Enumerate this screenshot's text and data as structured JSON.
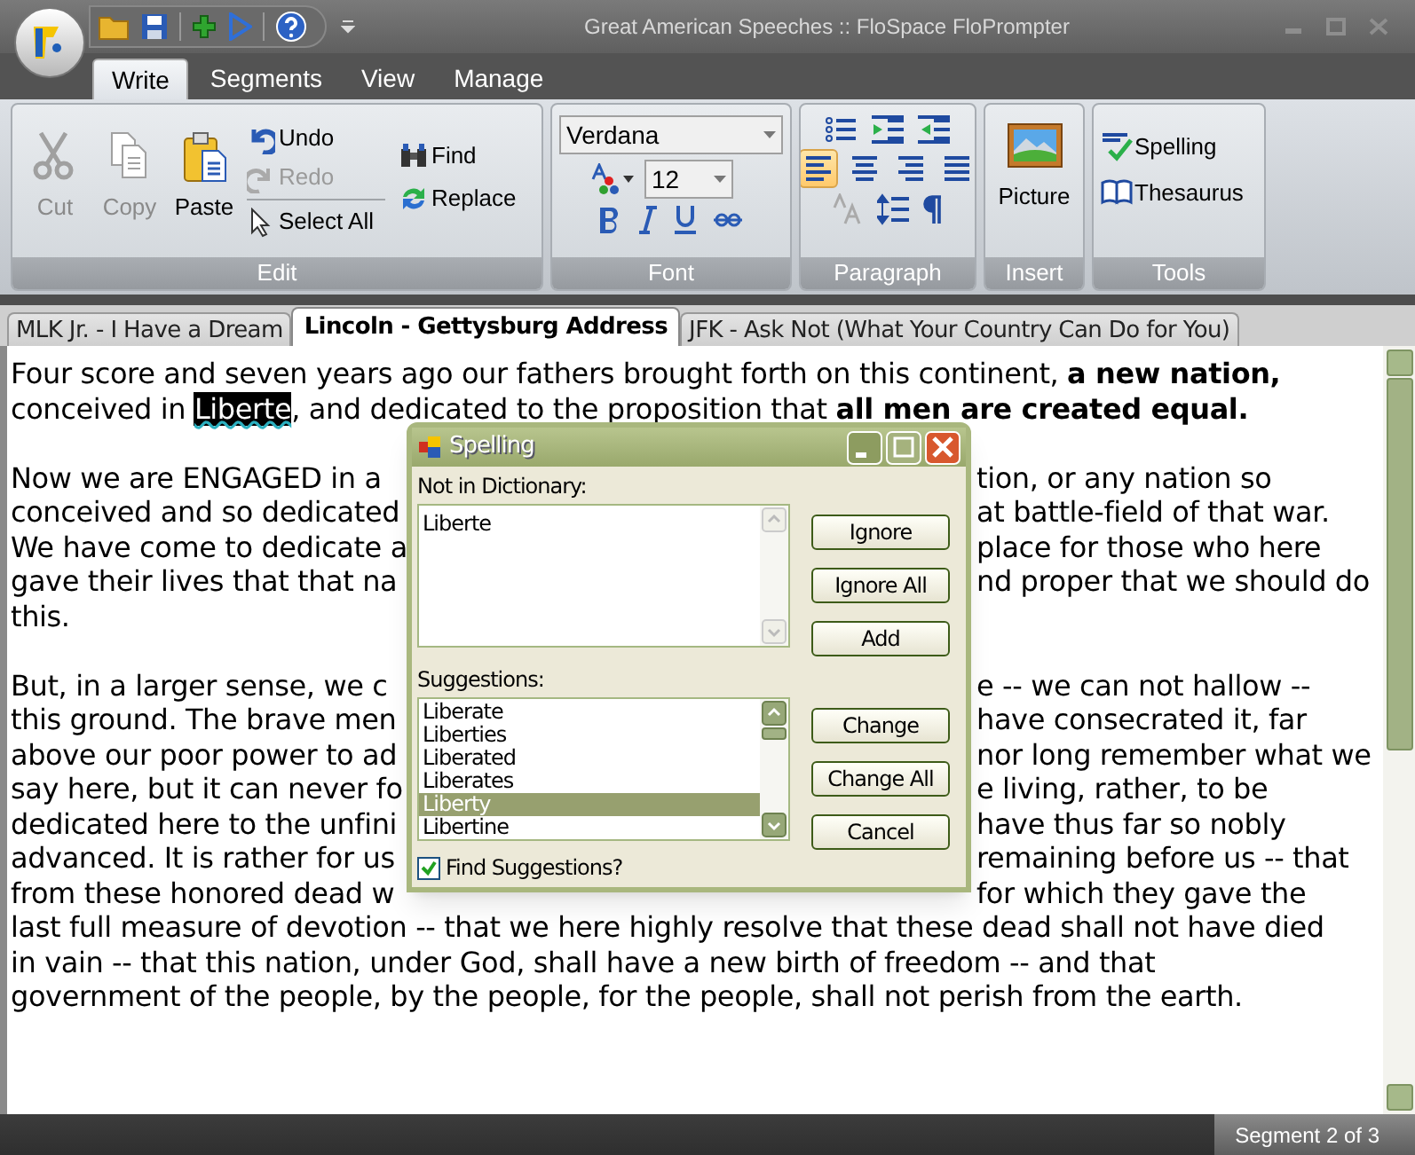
{
  "window": {
    "title": "Great American Speeches :: FloSpace FloPrompter"
  },
  "ribbon_tabs": [
    {
      "label": "Write",
      "selected": true
    },
    {
      "label": "Segments",
      "selected": false
    },
    {
      "label": "View",
      "selected": false
    },
    {
      "label": "Manage",
      "selected": false
    }
  ],
  "edit_group": {
    "label": "Edit",
    "commands": [
      {
        "label": "Cut",
        "disabled": true
      },
      {
        "label": "Copy",
        "disabled": true
      },
      {
        "label": "Paste",
        "disabled": false
      },
      {
        "label": "Undo",
        "disabled": false
      },
      {
        "label": "Redo",
        "disabled": true
      },
      {
        "label": "Select All",
        "disabled": false
      },
      {
        "label": "Find",
        "disabled": false
      },
      {
        "label": "Replace",
        "disabled": false
      }
    ]
  },
  "font_group": {
    "label": "Font",
    "font_name": "Verdana",
    "font_size": "12"
  },
  "paragraph_group": {
    "label": "Paragraph",
    "alignment": [
      {
        "selected": true
      },
      {
        "selected": false
      },
      {
        "selected": false
      },
      {
        "selected": false
      }
    ]
  },
  "insert_group": {
    "label": "Insert",
    "commands": [
      {
        "label": "Picture"
      }
    ]
  },
  "tools_group": {
    "label": "Tools",
    "commands": [
      {
        "label": "Spelling"
      },
      {
        "label": "Thesaurus"
      }
    ]
  },
  "document_tabs": [
    {
      "label": "MLK Jr. - I Have a Dream",
      "selected": false
    },
    {
      "label": "Lincoln - Gettysburg Address",
      "selected": true
    },
    {
      "label": "JFK - Ask Not (What Your Country Can Do for You)",
      "selected": false
    }
  ],
  "document": {
    "paragraphs": [
      [
        {
          "kind": "plain",
          "text": "Four score and seven years ago our fathers brought forth on this continent, **a new nation,**"
        },
        {
          "kind": "highlight",
          "before": "conceived in ",
          "highlighted": "Liberte",
          "after": ", and dedicated to the proposition that **all men are created equal.**"
        }
      ],
      [
        {
          "kind": "split",
          "text": "Now we are ENGAGED in a",
          "right": "tion, or any nation so"
        },
        {
          "kind": "split",
          "text": "conceived and so dedicated",
          "right": "at battle-field of that war."
        },
        {
          "kind": "split",
          "text": "We have come to dedicate a",
          "right": "place for those who here"
        },
        {
          "kind": "split",
          "text": "gave their lives that that na",
          "right": "nd proper that we should do"
        },
        {
          "kind": "plain",
          "text": "this."
        }
      ],
      [
        {
          "kind": "split",
          "text": "But, in a larger sense, we c",
          "right": "e -- we can not hallow --"
        },
        {
          "kind": "split",
          "text": "this ground. The brave men",
          "right": "have consecrated it, far"
        },
        {
          "kind": "split",
          "text": "above our poor power to ad",
          "right": "nor long remember what we"
        },
        {
          "kind": "split",
          "text": "say here, but it can never fo",
          "right": "e living, rather, to be"
        },
        {
          "kind": "split",
          "text": "dedicated here to the unfini",
          "right": "have thus far so nobly"
        },
        {
          "kind": "split",
          "text": "advanced. It is rather for us",
          "right": "remaining before us -- that"
        },
        {
          "kind": "split",
          "text": "from these honored dead w",
          "right": "for which they gave the"
        },
        {
          "kind": "plain",
          "text": "last full measure of devotion -- that we here highly resolve that these dead shall not have died"
        },
        {
          "kind": "plain",
          "text": "in vain -- that this nation, under God, shall have a new birth of freedom -- and that"
        },
        {
          "kind": "plain",
          "text": "government of the people, by the people, for the people, shall not perish from the earth."
        }
      ]
    ]
  },
  "spelling_dialog": {
    "title": "Spelling",
    "not_in_dictionary_label": "Not in Dictionary:",
    "not_in_dictionary": "Liberte",
    "suggestions_label": "Suggestions:",
    "suggestions": [
      {
        "label": "Liberate",
        "selected": false
      },
      {
        "label": "Liberties",
        "selected": false
      },
      {
        "label": "Liberated",
        "selected": false
      },
      {
        "label": "Liberates",
        "selected": false
      },
      {
        "label": "Liberty",
        "selected": true
      },
      {
        "label": "Libertine",
        "selected": false
      }
    ],
    "buttons_top": [
      "Ignore",
      "Ignore All",
      "Add"
    ],
    "buttons_bottom": [
      "Change",
      "Change All",
      "Cancel"
    ],
    "find_suggestions": {
      "label": "Find Suggestions?",
      "checked": true
    }
  },
  "status_bar": {
    "segment": "Segment 2 of 3"
  }
}
